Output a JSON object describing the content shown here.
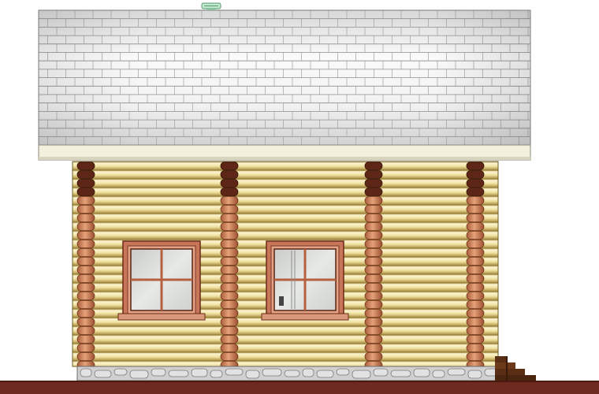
{
  "colors": {
    "background": "#ffffff",
    "roof_light": "#f4f4f4",
    "roof_shade": "#c9c9c9",
    "roof_lines": "#8a8a8a",
    "fascia": "#f3efdc",
    "log_light": "#fbf3c8",
    "log_mid": "#e8d88a",
    "log_dark": "#bfa54e",
    "corner_log": "#d38a63",
    "corner_log_dark": "#5a2414",
    "window_frame": "#c9785a",
    "window_frame_dark": "#6a2a18",
    "glass": "#d9dcd8",
    "foundation": "#c8c8c8",
    "ground": "#6e2a1e",
    "vent": "#9fd8b0"
  },
  "icons": {
    "roof_vent": "roof-vent-icon",
    "stairs": "entry-steps-icon"
  }
}
